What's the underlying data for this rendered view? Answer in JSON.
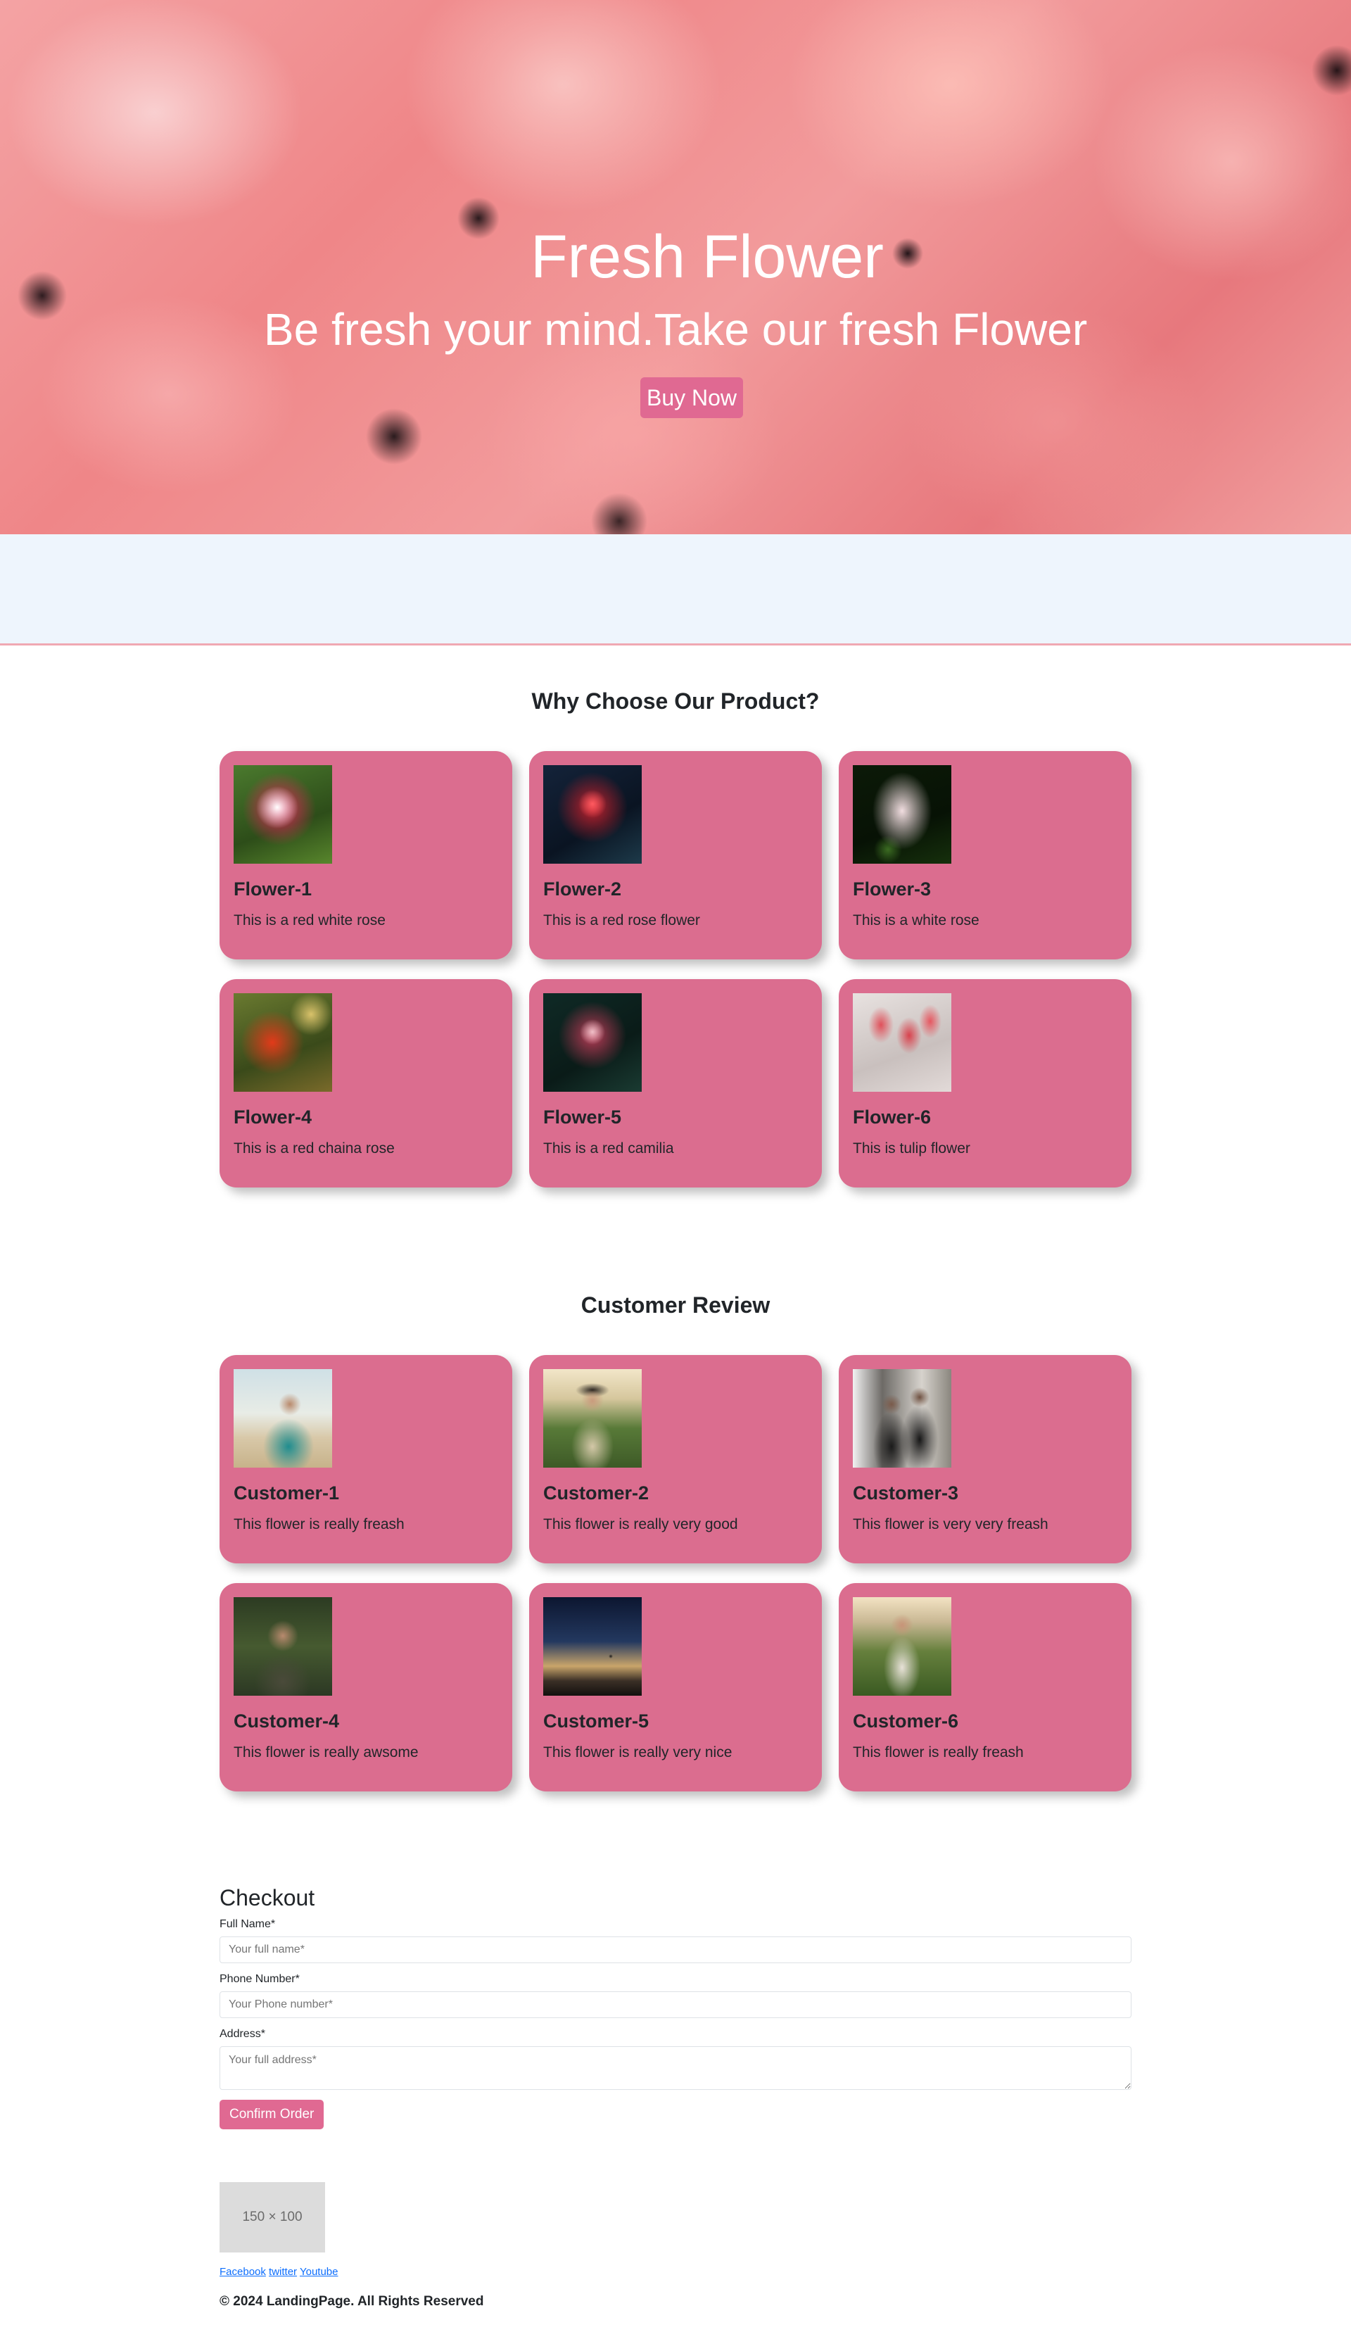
{
  "hero": {
    "title": "Fresh Flower",
    "subtitle": "Be fresh your mind.Take our fresh Flower",
    "button_label": "Buy Now"
  },
  "products": {
    "heading": "Why Choose Our Product?",
    "items": [
      {
        "title": "Flower-1",
        "text": "This is a red white rose"
      },
      {
        "title": "Flower-2",
        "text": "This is a red rose flower"
      },
      {
        "title": "Flower-3",
        "text": "This is a white rose"
      },
      {
        "title": "Flower-4",
        "text": "This is a red chaina rose"
      },
      {
        "title": "Flower-5",
        "text": "This is a red camilia"
      },
      {
        "title": "Flower-6",
        "text": "This is tulip flower"
      }
    ]
  },
  "reviews": {
    "heading": "Customer Review",
    "items": [
      {
        "title": "Customer-1",
        "text": "This flower is really freash"
      },
      {
        "title": "Customer-2",
        "text": "This flower is really very good"
      },
      {
        "title": "Customer-3",
        "text": "This flower is very very freash"
      },
      {
        "title": "Customer-4",
        "text": "This flower is really awsome"
      },
      {
        "title": "Customer-5",
        "text": "This flower is really very nice"
      },
      {
        "title": "Customer-6",
        "text": "This flower is really freash"
      }
    ]
  },
  "checkout": {
    "heading": "Checkout",
    "full_name_label": "Full Name*",
    "full_name_placeholder": "Your full name*",
    "phone_label": "Phone Number*",
    "phone_placeholder": "Your Phone number*",
    "address_label": "Address*",
    "address_placeholder": "Your full address*",
    "confirm_label": "Confirm Order"
  },
  "footer": {
    "image_placeholder": "150 × 100",
    "links": [
      "Facebook",
      "twitter",
      "Youtube"
    ],
    "copyright": "© 2024 LandingPage. All Rights Reserved"
  },
  "colors": {
    "accent": "#e06992",
    "card": "#db6d8f",
    "band": "#eef5fd",
    "link": "#0d6efd"
  }
}
